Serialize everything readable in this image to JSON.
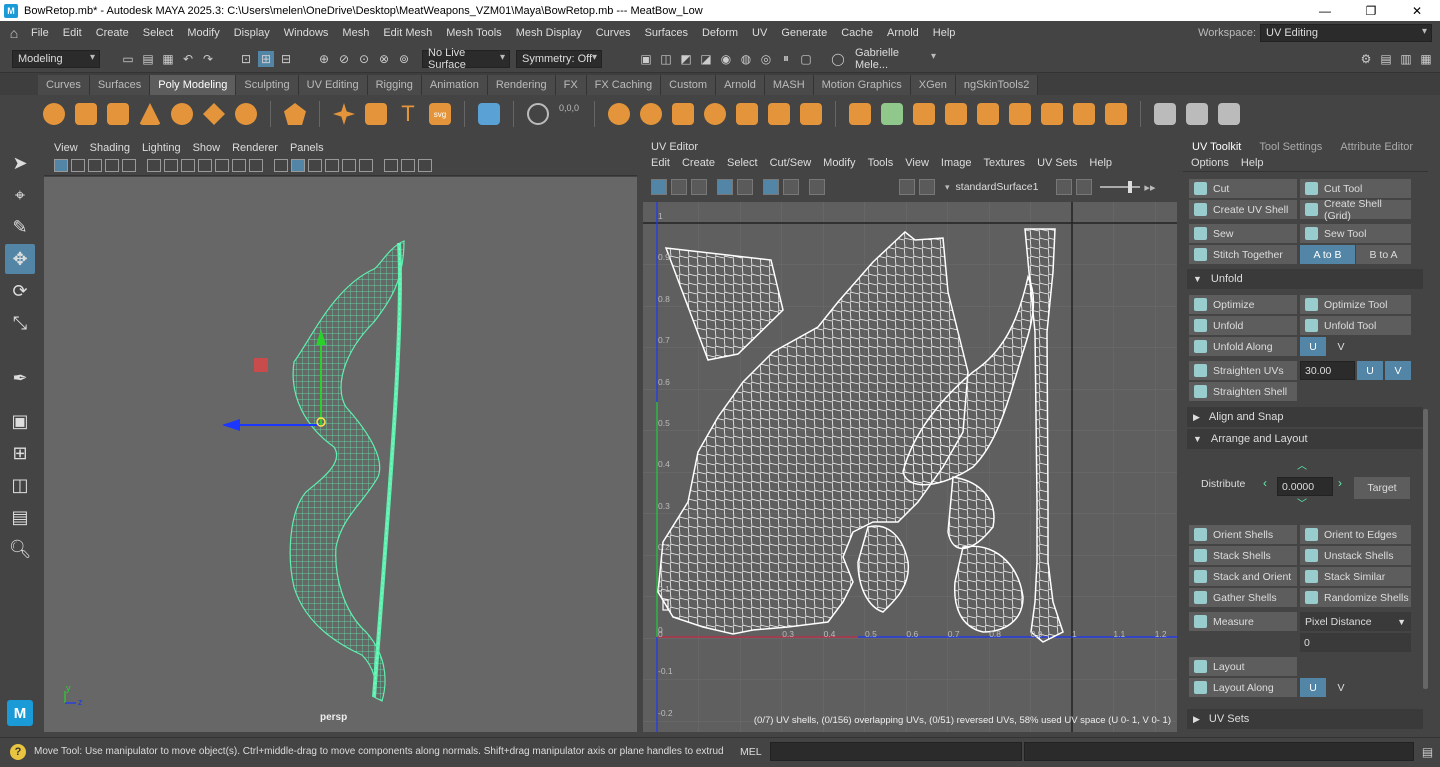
{
  "title": {
    "text": "BowRetop.mb* - Autodesk MAYA 2025.3: C:\\Users\\melen\\OneDrive\\Desktop\\MeatWeapons_VZM01\\Maya\\BowRetop.mb --- MeatBow_Low",
    "minimize": "—",
    "maximize": "❐",
    "close": "✕"
  },
  "menubar": [
    "File",
    "Edit",
    "Create",
    "Select",
    "Modify",
    "Display",
    "Windows",
    "Mesh",
    "Edit Mesh",
    "Mesh Tools",
    "Mesh Display",
    "Curves",
    "Surfaces",
    "Deform",
    "UV",
    "Generate",
    "Cache",
    "Arnold",
    "Help"
  ],
  "workspace": {
    "label": "Workspace:",
    "value": "UV Editing"
  },
  "statusline": {
    "mode": "Modeling",
    "live_surface": "No Live Surface",
    "symmetry": "Symmetry: Off",
    "user": "Gabrielle Mele..."
  },
  "shelf_tabs": [
    "Curves",
    "Surfaces",
    "Poly Modeling",
    "Sculpting",
    "UV Editing",
    "Rigging",
    "Animation",
    "Rendering",
    "FX",
    "FX Caching",
    "Custom",
    "Arnold",
    "MASH",
    "Motion Graphics",
    "XGen",
    "ngSkinTools2"
  ],
  "shelf_active": "Poly Modeling",
  "viewport": {
    "menu": [
      "View",
      "Shading",
      "Lighting",
      "Show",
      "Renderer",
      "Panels"
    ],
    "camera": "persp",
    "axis_y": "y",
    "axis_z": "z"
  },
  "uv_editor": {
    "title": "UV Editor",
    "menu": [
      "Edit",
      "Create",
      "Select",
      "Cut/Sew",
      "Modify",
      "Tools",
      "View",
      "Image",
      "Textures",
      "UV Sets",
      "Help"
    ],
    "material": "standardSurface1",
    "status": "(0/7) UV shells, (0/156) overlapping UVs, (0/51) reversed UVs, 58% used UV space (U  0- 1, V  0- 1)",
    "y_ticks": [
      "1",
      "0.9",
      "0.8",
      "0.7",
      "0.6",
      "0.5",
      "0.4",
      "0.3",
      "0.2",
      "0.1",
      "0",
      "-0.1",
      "-0.2"
    ],
    "x_ticks": [
      "0",
      "0.3",
      "0.4",
      "0.5",
      "0.6",
      "0.7",
      "0.8",
      "0.9",
      "1",
      "1.1",
      "1.2"
    ]
  },
  "toolkit": {
    "tabs": [
      "UV Toolkit",
      "Tool Settings",
      "Attribute Editor"
    ],
    "menu": [
      "Options",
      "Help"
    ],
    "cut": "Cut",
    "cut_tool": "Cut Tool",
    "create_uv_shell": "Create UV Shell",
    "create_shell_grid": "Create Shell (Grid)",
    "sew": "Sew",
    "sew_tool": "Sew Tool",
    "stitch_together": "Stitch Together",
    "a_to_b": "A to B",
    "b_to_a": "B to A",
    "unfold_section": "Unfold",
    "optimize": "Optimize",
    "optimize_tool": "Optimize Tool",
    "unfold": "Unfold",
    "unfold_tool": "Unfold Tool",
    "unfold_along": "Unfold Along",
    "u": "U",
    "v": "V",
    "straighten_uvs": "Straighten UVs",
    "straighten_value": "30.00",
    "straighten_shell": "Straighten Shell",
    "align_section": "Align and Snap",
    "arrange_section": "Arrange and Layout",
    "distribute": "Distribute",
    "distribute_value": "0.0000",
    "target": "Target",
    "orient_shells": "Orient Shells",
    "orient_to_edges": "Orient to Edges",
    "stack_shells": "Stack Shells",
    "unstack_shells": "Unstack Shells",
    "stack_and_orient": "Stack and Orient",
    "stack_similar": "Stack Similar",
    "gather_shells": "Gather Shells",
    "randomize_shells": "Randomize Shells",
    "measure": "Measure",
    "measure_mode": "Pixel Distance",
    "measure_value": "0",
    "layout": "Layout",
    "layout_along": "Layout Along",
    "uv_sets_section": "UV Sets"
  },
  "helpline": {
    "text": "Move Tool: Use manipulator to move object(s). Ctrl+middle-drag to move components along normals. Shift+drag manipulator axis or plane handles to extrude components",
    "mel": "MEL"
  },
  "colors": {
    "accent": "#5285a6",
    "wire": "#5ff0b0",
    "bg": "#444444"
  }
}
